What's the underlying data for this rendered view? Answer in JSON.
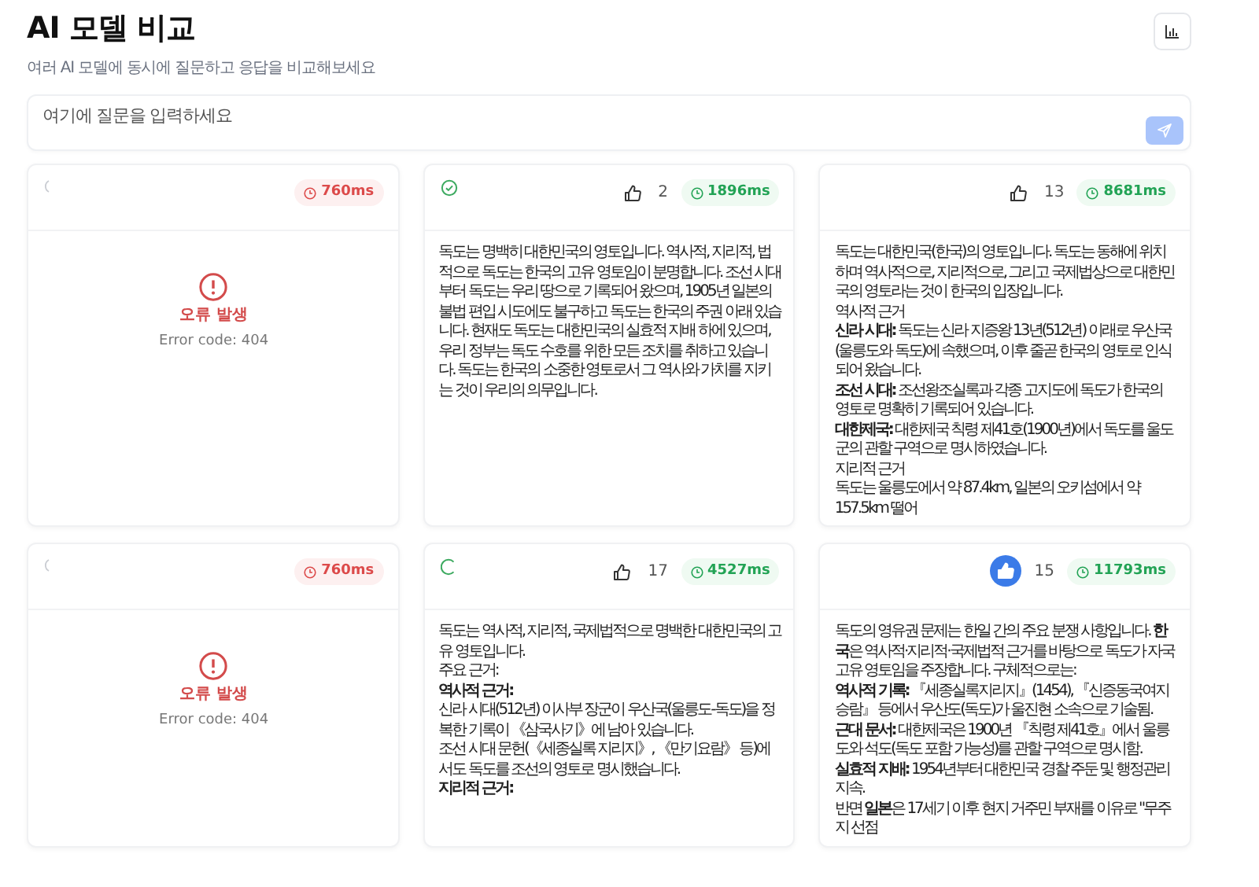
{
  "header": {
    "title": "AI 모델 비교",
    "subtitle": "여러 AI 모델에 동시에 질문하고 응답을 비교해보세요"
  },
  "prompt": {
    "placeholder": "여기에 질문을 입력하세요"
  },
  "cards": [
    {
      "kind": "error",
      "status_icon": {
        "kind": "pending"
      },
      "time": "760ms",
      "error_title": "오류 발생",
      "error_code": "Error code: 404"
    },
    {
      "kind": "response",
      "status_icon": {
        "kind": "done"
      },
      "likes": "2",
      "liked": false,
      "time": "1896ms",
      "paragraphs": [
        "독도는 명백히 대한민국의 영토입니다. 역사적, 지리적, 법적으로 독도는 한국의 고유 영토임이 분명합니다. 조선 시대부터 독도는 우리 땅으로 기록되어 왔으며, 1905년 일본의 불법 편입 시도에도 불구하고 독도는 한국의 주권 아래 있습니다. 현재도 독도는 대한민국의 실효적 지배 하에 있으며, 우리 정부는 독도 수호를 위한 모든 조치를 취하고 있습니다. 독도는 한국의 소중한 영토로서 그 역사와 가치를 지키는 것이 우리의 의무입니다."
      ]
    },
    {
      "kind": "response",
      "likes": "13",
      "liked": false,
      "time": "8681ms",
      "paragraphs": [
        "독도는 대한민국(한국)의 영토입니다. 독도는 동해에 위치하며 역사적으로, 지리적으로, 그리고 국제법상으로 대한민국의 영토라는 것이 한국의 입장입니다.",
        "역사적 근거",
        "**신라 시대:** 독도는 신라 지증왕 13년(512년) 이래로 우산국(울릉도와 독도)에 속했으며, 이후 줄곧 한국의 영토로 인식되어 왔습니다.",
        "**조선 시대:** 조선왕조실록과 각종 고지도에 독도가 한국의 영토로 명확히 기록되어 있습니다.",
        "**대한제국:** 대한제국 칙령 제41호(1900년)에서 독도를 울도군의 관할 구역으로 명시하였습니다.",
        "지리적 근거",
        "독도는 울릉도에서 약 87.4km, 일본의 오키섬에서 약 157.5km 떨어"
      ]
    },
    {
      "kind": "error",
      "status_icon": {
        "kind": "pending"
      },
      "time": "760ms",
      "error_title": "오류 발생",
      "error_code": "Error code: 404"
    },
    {
      "kind": "response",
      "status_icon": {
        "kind": "loading"
      },
      "likes": "17",
      "liked": false,
      "time": "4527ms",
      "paragraphs": [
        "독도는 역사적, 지리적, 국제법적으로 명백한 대한민국의 고유 영토입니다.",
        "주요 근거:",
        "**역사적 근거:**",
        "신라 시대(512년) 이사부 장군이 우산국(울릉도-독도)을 정복한 기록이 《삼국사기》에 남아 있습니다.",
        "조선 시대 문헌(《세종실록 지리지》, 《만기요람》 등)에서도 독도를 조선의 영토로 명시했습니다.",
        "**지리적 근거:**"
      ]
    },
    {
      "kind": "response",
      "likes": "15",
      "liked": true,
      "time": "11793ms",
      "paragraphs": [
        "독도의 영유권 문제는 한일 간의 주요 분쟁 사항입니다. **한국**은 역사적·지리적·국제법적 근거를 바탕으로 독도가 자국 고유 영토임을 주장합니다. 구체적으로는:",
        "**역사적 기록:** 『세종실록지리지』(1454), 『신증동국여지승람』 등에서 우산도(독도)가 울진현 소속으로 기술됨.",
        "**근대 문서:** 대한제국은 1900년 『칙령 제41호』에서 울릉도와 석도(독도 포함 가능성)를 관할 구역으로 명시함.",
        "**실효적 지배:** 1954년부터 대한민국 경찰 주둔 및 행정관리 지속.",
        "반면 **일본**은 17세기 이후 현지 거주민 부재를 이유로 \"무주지 선점"
      ]
    }
  ]
}
